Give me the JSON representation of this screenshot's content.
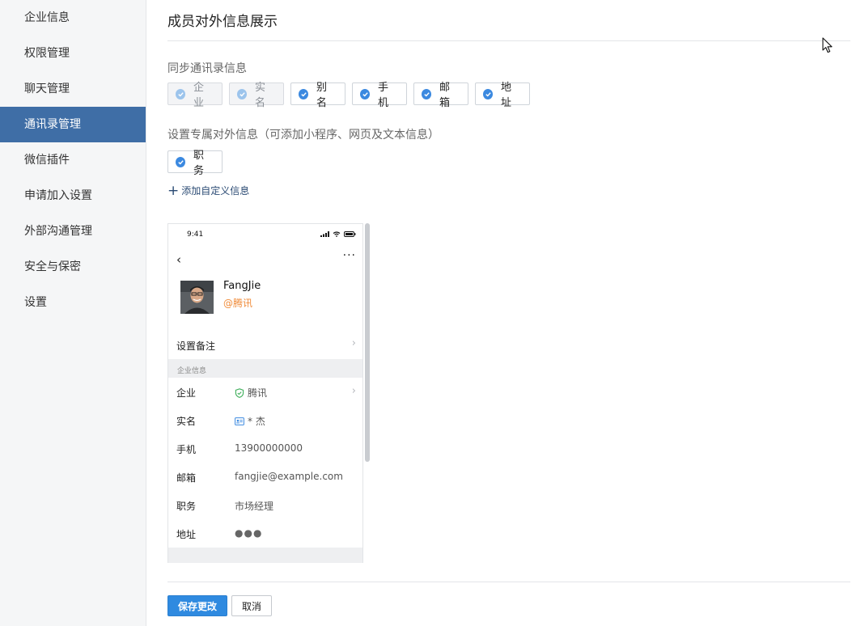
{
  "sidebar": {
    "items": [
      {
        "label": "企业信息"
      },
      {
        "label": "权限管理"
      },
      {
        "label": "聊天管理"
      },
      {
        "label": "通讯录管理",
        "active": true
      },
      {
        "label": "微信插件"
      },
      {
        "label": "申请加入设置"
      },
      {
        "label": "外部沟通管理"
      },
      {
        "label": "安全与保密"
      },
      {
        "label": "设置"
      }
    ]
  },
  "main": {
    "title": "成员对外信息展示",
    "sync_section": {
      "label": "同步通讯录信息",
      "chips": [
        {
          "label": "企业",
          "disabled": true
        },
        {
          "label": "实名",
          "disabled": true
        },
        {
          "label": "别名",
          "disabled": false
        },
        {
          "label": "手机",
          "disabled": false
        },
        {
          "label": "邮箱",
          "disabled": false
        },
        {
          "label": "地址",
          "disabled": false
        }
      ]
    },
    "custom_section": {
      "label": "设置专属对外信息（可添加小程序、网页及文本信息）",
      "chips": [
        {
          "label": "职务",
          "disabled": false
        }
      ],
      "add_label": "添加自定义信息"
    },
    "preview": {
      "time": "9:41",
      "name": "FangJie",
      "org": "@腾讯",
      "remark_label": "设置备注",
      "section_label": "企业信息",
      "rows": [
        {
          "key": "企业",
          "value": "腾讯"
        },
        {
          "key": "实名",
          "value": "* 杰"
        },
        {
          "key": "手机",
          "value": "13900000000"
        },
        {
          "key": "邮箱",
          "value": "fangjie@example.com"
        },
        {
          "key": "职务",
          "value": "市场经理"
        },
        {
          "key": "地址",
          "value": "●●●"
        }
      ]
    },
    "footer": {
      "save_label": "保存更改",
      "cancel_label": "取消"
    }
  },
  "colors": {
    "accent": "#2f8ae0",
    "sidebar_active": "#3f6ea6",
    "org_text": "#f08c3a"
  }
}
